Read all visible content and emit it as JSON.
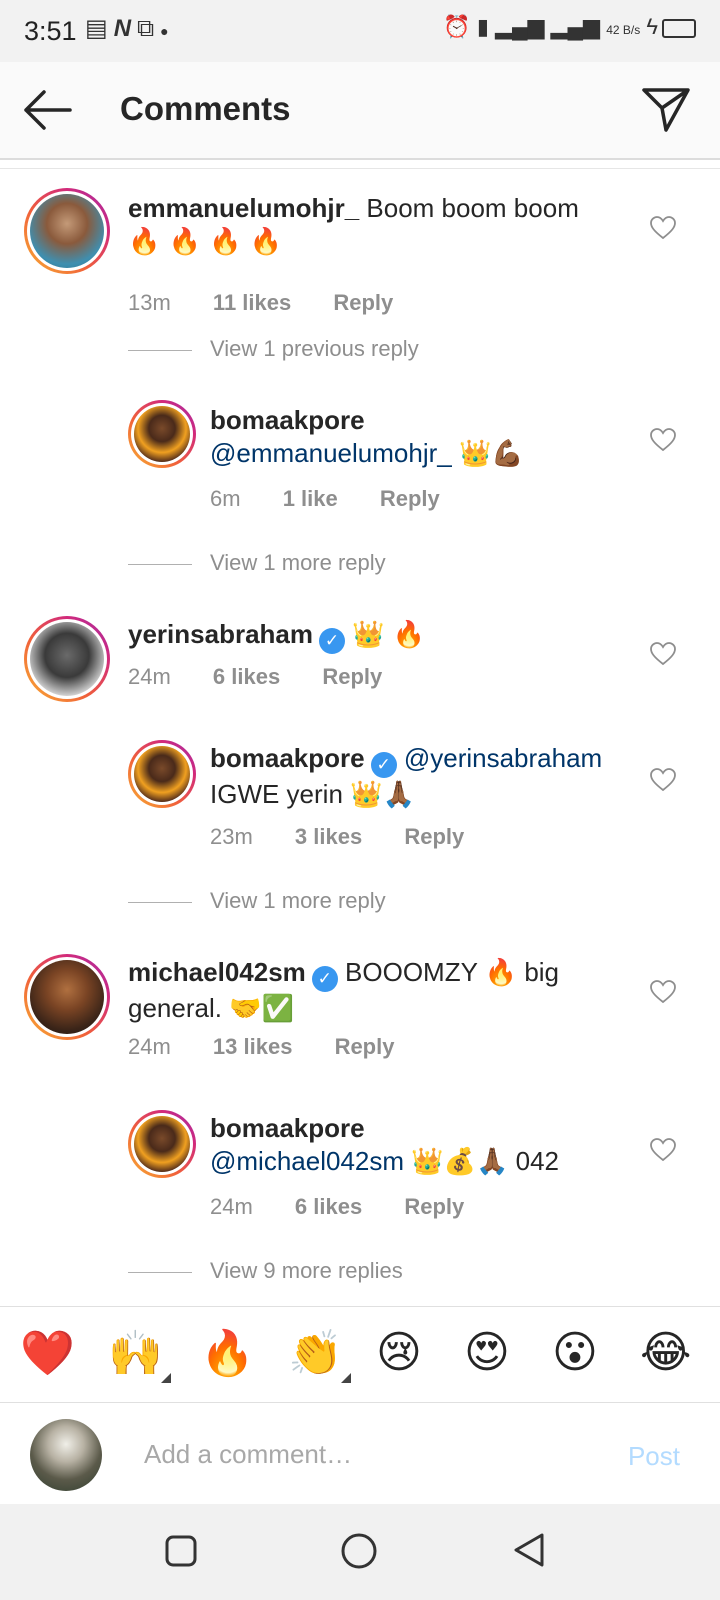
{
  "status_bar": {
    "time": "3:51",
    "network_speed": "42 B/s"
  },
  "header": {
    "title": "Comments"
  },
  "comments": [
    {
      "username": "emmanuelumohjr_",
      "verified": false,
      "text": "Boom boom boom",
      "emoji": "🔥 🔥 🔥 🔥",
      "time": "13m",
      "likes": "11 likes",
      "reply": "Reply",
      "avatar": "avatar-emmanuelumohjr"
    },
    {
      "username": "bomaakpore",
      "verified": false,
      "mention": "@emmanuelumohjr_",
      "text": "",
      "emoji": "👑💪🏾",
      "time": "6m",
      "likes": "1 like",
      "reply": "Reply",
      "avatar": "avatar-bomaakpore"
    },
    {
      "username": "yerinsabraham",
      "verified": true,
      "text": "",
      "emoji": "👑 🔥",
      "time": "24m",
      "likes": "6 likes",
      "reply": "Reply",
      "avatar": "avatar-yerinsabraham"
    },
    {
      "username": "bomaakpore",
      "verified": true,
      "mention": "@yerinsabraham",
      "text": "IGWE yerin",
      "emoji": "👑🙏🏾",
      "time": "23m",
      "likes": "3 likes",
      "reply": "Reply",
      "avatar": "avatar-bomaakpore"
    },
    {
      "username": "michael042sm",
      "verified": true,
      "text": "BOOOMZY",
      "emoji1": "🔥",
      "text2": "big general.",
      "emoji": "🤝✅",
      "time": "24m",
      "likes": "13 likes",
      "reply": "Reply",
      "avatar": "avatar-michael042sm"
    },
    {
      "username": "bomaakpore",
      "verified": false,
      "mention": "@michael042sm",
      "text": "042",
      "emoji": "👑💰🙏🏾",
      "time": "24m",
      "likes": "6 likes",
      "reply": "Reply",
      "avatar": "avatar-bomaakpore"
    }
  ],
  "view_replies": {
    "previous_1": "View 1 previous reply",
    "more_1a": "View 1 more reply",
    "more_1b": "View 1 more reply",
    "more_9": "View 9 more replies"
  },
  "reactions": [
    "❤️",
    "🙌",
    "🔥",
    "👏",
    "😢",
    "😍",
    "😮",
    "😂"
  ],
  "composer": {
    "placeholder": "Add a comment…",
    "post_label": "Post"
  },
  "colors": {
    "accent_blue": "#3897f0",
    "mention_blue": "#003569",
    "post_disabled": "#b3dbff",
    "muted": "#8e8e8e"
  }
}
